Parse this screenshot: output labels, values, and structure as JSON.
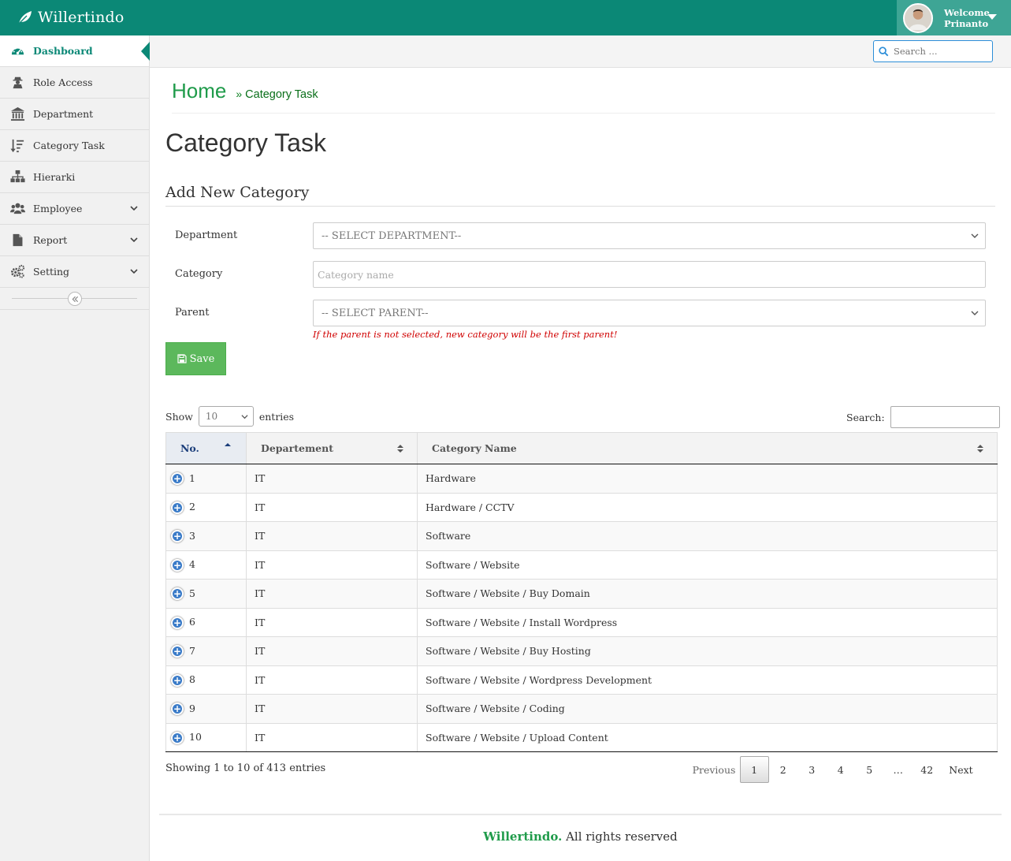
{
  "app": {
    "brand": "Willertindo",
    "welcome_line1": "Welcome,",
    "welcome_line2": "Prinanto",
    "search_placeholder": "Search ..."
  },
  "sidebar": {
    "items": [
      {
        "label": "Dashboard",
        "icon": "dashboard-icon",
        "active": true
      },
      {
        "label": "Role Access",
        "icon": "user-secret-icon"
      },
      {
        "label": "Department",
        "icon": "bank-icon"
      },
      {
        "label": "Category Task",
        "icon": "sort-amount-icon"
      },
      {
        "label": "Hierarki",
        "icon": "sitemap-icon"
      },
      {
        "label": "Employee",
        "icon": "users-icon",
        "expandable": true
      },
      {
        "label": "Report",
        "icon": "file-icon",
        "expandable": true
      },
      {
        "label": "Setting",
        "icon": "gears-icon",
        "expandable": true
      }
    ]
  },
  "breadcrumb": {
    "home": "Home",
    "separator": "»",
    "current": "Category Task"
  },
  "page": {
    "title": "Category Task",
    "section_title": "Add New Category"
  },
  "form": {
    "department_label": "Department",
    "department_value": "-- SELECT DEPARTMENT--",
    "category_label": "Category",
    "category_placeholder": "Category name",
    "parent_label": "Parent",
    "parent_value": "-- SELECT PARENT--",
    "help_text": "If the parent is not selected, new category will be the first parent!",
    "save_label": "Save"
  },
  "table_controls": {
    "show_label": "Show",
    "length_value": "10",
    "entries_label": "entries",
    "search_label": "Search:"
  },
  "table": {
    "columns": [
      "No.",
      "Departement",
      "Category Name"
    ],
    "rows": [
      {
        "no": "1",
        "dept": "IT",
        "name": "Hardware"
      },
      {
        "no": "2",
        "dept": "IT",
        "name": "Hardware / CCTV"
      },
      {
        "no": "3",
        "dept": "IT",
        "name": "Software"
      },
      {
        "no": "4",
        "dept": "IT",
        "name": "Software / Website"
      },
      {
        "no": "5",
        "dept": "IT",
        "name": "Software / Website / Buy Domain"
      },
      {
        "no": "6",
        "dept": "IT",
        "name": "Software / Website / Install Wordpress"
      },
      {
        "no": "7",
        "dept": "IT",
        "name": "Software / Website / Buy Hosting"
      },
      {
        "no": "8",
        "dept": "IT",
        "name": "Software / Website / Wordpress Development"
      },
      {
        "no": "9",
        "dept": "IT",
        "name": "Software / Website / Coding"
      },
      {
        "no": "10",
        "dept": "IT",
        "name": "Software / Website / Upload Content"
      }
    ]
  },
  "pagination": {
    "info": "Showing 1 to 10 of 413 entries",
    "previous": "Previous",
    "pages": [
      "1",
      "2",
      "3",
      "4",
      "5"
    ],
    "ellipsis": "…",
    "last": "42",
    "next": "Next",
    "current": "1"
  },
  "footer": {
    "brand": "Willertindo.",
    "text": " All rights reserved"
  },
  "colors": {
    "topbar": "#0b8876",
    "user_box": "#3ea595",
    "accent_green": "#1f9b4a",
    "save_button": "#5cb85c",
    "help_text": "#d00000",
    "expand_icon": "#3a7bc8"
  }
}
